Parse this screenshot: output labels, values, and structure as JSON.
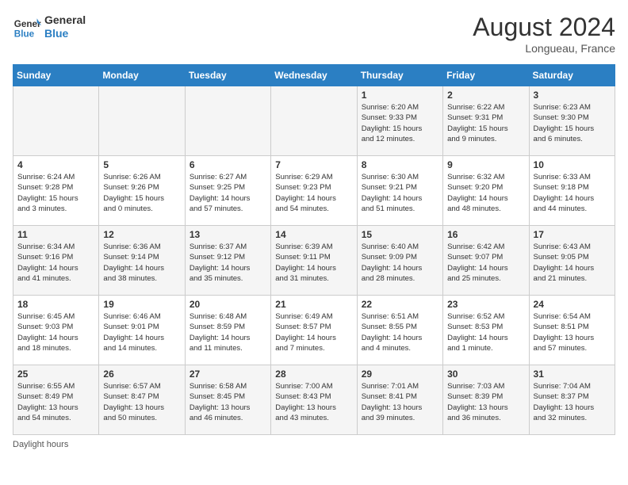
{
  "header": {
    "logo_line1": "General",
    "logo_line2": "Blue",
    "month_year": "August 2024",
    "location": "Longueau, France"
  },
  "days_of_week": [
    "Sunday",
    "Monday",
    "Tuesday",
    "Wednesday",
    "Thursday",
    "Friday",
    "Saturday"
  ],
  "weeks": [
    [
      {
        "day": "",
        "info": ""
      },
      {
        "day": "",
        "info": ""
      },
      {
        "day": "",
        "info": ""
      },
      {
        "day": "",
        "info": ""
      },
      {
        "day": "1",
        "info": "Sunrise: 6:20 AM\nSunset: 9:33 PM\nDaylight: 15 hours\nand 12 minutes."
      },
      {
        "day": "2",
        "info": "Sunrise: 6:22 AM\nSunset: 9:31 PM\nDaylight: 15 hours\nand 9 minutes."
      },
      {
        "day": "3",
        "info": "Sunrise: 6:23 AM\nSunset: 9:30 PM\nDaylight: 15 hours\nand 6 minutes."
      }
    ],
    [
      {
        "day": "4",
        "info": "Sunrise: 6:24 AM\nSunset: 9:28 PM\nDaylight: 15 hours\nand 3 minutes."
      },
      {
        "day": "5",
        "info": "Sunrise: 6:26 AM\nSunset: 9:26 PM\nDaylight: 15 hours\nand 0 minutes."
      },
      {
        "day": "6",
        "info": "Sunrise: 6:27 AM\nSunset: 9:25 PM\nDaylight: 14 hours\nand 57 minutes."
      },
      {
        "day": "7",
        "info": "Sunrise: 6:29 AM\nSunset: 9:23 PM\nDaylight: 14 hours\nand 54 minutes."
      },
      {
        "day": "8",
        "info": "Sunrise: 6:30 AM\nSunset: 9:21 PM\nDaylight: 14 hours\nand 51 minutes."
      },
      {
        "day": "9",
        "info": "Sunrise: 6:32 AM\nSunset: 9:20 PM\nDaylight: 14 hours\nand 48 minutes."
      },
      {
        "day": "10",
        "info": "Sunrise: 6:33 AM\nSunset: 9:18 PM\nDaylight: 14 hours\nand 44 minutes."
      }
    ],
    [
      {
        "day": "11",
        "info": "Sunrise: 6:34 AM\nSunset: 9:16 PM\nDaylight: 14 hours\nand 41 minutes."
      },
      {
        "day": "12",
        "info": "Sunrise: 6:36 AM\nSunset: 9:14 PM\nDaylight: 14 hours\nand 38 minutes."
      },
      {
        "day": "13",
        "info": "Sunrise: 6:37 AM\nSunset: 9:12 PM\nDaylight: 14 hours\nand 35 minutes."
      },
      {
        "day": "14",
        "info": "Sunrise: 6:39 AM\nSunset: 9:11 PM\nDaylight: 14 hours\nand 31 minutes."
      },
      {
        "day": "15",
        "info": "Sunrise: 6:40 AM\nSunset: 9:09 PM\nDaylight: 14 hours\nand 28 minutes."
      },
      {
        "day": "16",
        "info": "Sunrise: 6:42 AM\nSunset: 9:07 PM\nDaylight: 14 hours\nand 25 minutes."
      },
      {
        "day": "17",
        "info": "Sunrise: 6:43 AM\nSunset: 9:05 PM\nDaylight: 14 hours\nand 21 minutes."
      }
    ],
    [
      {
        "day": "18",
        "info": "Sunrise: 6:45 AM\nSunset: 9:03 PM\nDaylight: 14 hours\nand 18 minutes."
      },
      {
        "day": "19",
        "info": "Sunrise: 6:46 AM\nSunset: 9:01 PM\nDaylight: 14 hours\nand 14 minutes."
      },
      {
        "day": "20",
        "info": "Sunrise: 6:48 AM\nSunset: 8:59 PM\nDaylight: 14 hours\nand 11 minutes."
      },
      {
        "day": "21",
        "info": "Sunrise: 6:49 AM\nSunset: 8:57 PM\nDaylight: 14 hours\nand 7 minutes."
      },
      {
        "day": "22",
        "info": "Sunrise: 6:51 AM\nSunset: 8:55 PM\nDaylight: 14 hours\nand 4 minutes."
      },
      {
        "day": "23",
        "info": "Sunrise: 6:52 AM\nSunset: 8:53 PM\nDaylight: 14 hours\nand 1 minute."
      },
      {
        "day": "24",
        "info": "Sunrise: 6:54 AM\nSunset: 8:51 PM\nDaylight: 13 hours\nand 57 minutes."
      }
    ],
    [
      {
        "day": "25",
        "info": "Sunrise: 6:55 AM\nSunset: 8:49 PM\nDaylight: 13 hours\nand 54 minutes."
      },
      {
        "day": "26",
        "info": "Sunrise: 6:57 AM\nSunset: 8:47 PM\nDaylight: 13 hours\nand 50 minutes."
      },
      {
        "day": "27",
        "info": "Sunrise: 6:58 AM\nSunset: 8:45 PM\nDaylight: 13 hours\nand 46 minutes."
      },
      {
        "day": "28",
        "info": "Sunrise: 7:00 AM\nSunset: 8:43 PM\nDaylight: 13 hours\nand 43 minutes."
      },
      {
        "day": "29",
        "info": "Sunrise: 7:01 AM\nSunset: 8:41 PM\nDaylight: 13 hours\nand 39 minutes."
      },
      {
        "day": "30",
        "info": "Sunrise: 7:03 AM\nSunset: 8:39 PM\nDaylight: 13 hours\nand 36 minutes."
      },
      {
        "day": "31",
        "info": "Sunrise: 7:04 AM\nSunset: 8:37 PM\nDaylight: 13 hours\nand 32 minutes."
      }
    ]
  ],
  "footer_label": "Daylight hours"
}
